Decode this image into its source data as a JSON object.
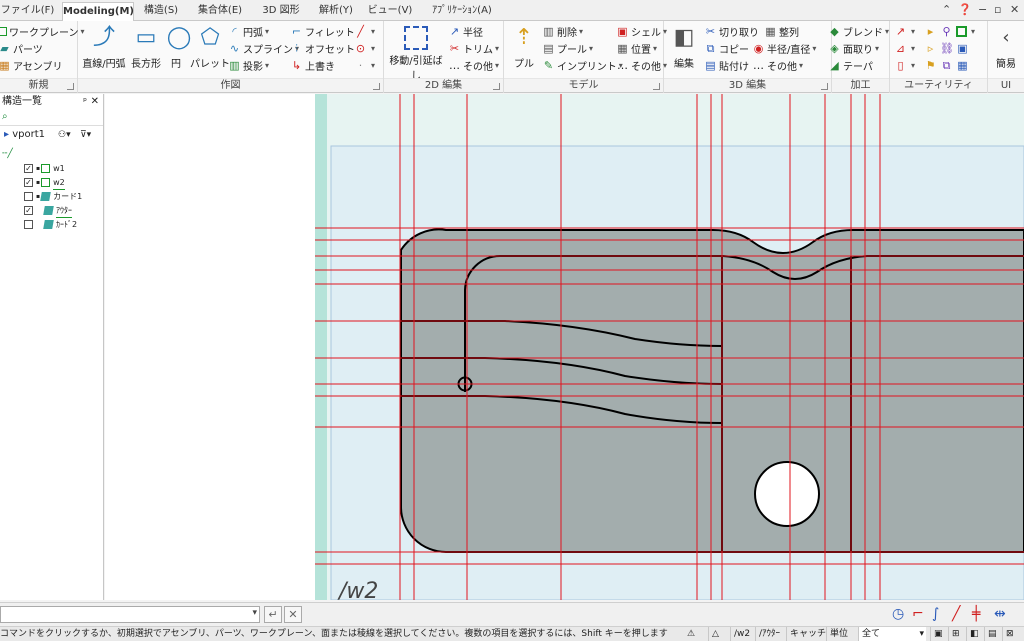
{
  "tabs": [
    {
      "label": "ファイル(F)",
      "active": false
    },
    {
      "label": "Modeling(M)",
      "active": true
    },
    {
      "label": "構造(S)",
      "active": false
    },
    {
      "label": "集合体(E)",
      "active": false
    },
    {
      "label": "3D 図形",
      "active": false
    },
    {
      "label": "解析(Y)",
      "active": false
    },
    {
      "label": "ビュー(V)",
      "active": false
    },
    {
      "label": "ｱﾌﾟﾘｹｰｼｮﾝ(A)",
      "active": false
    }
  ],
  "ribbon": {
    "groups": {
      "new": "新規",
      "draw": "作図",
      "edit2d": "2D 編集",
      "model": "モデル",
      "edit3d": "3D 編集",
      "machining": "加工",
      "utility": "ユーティリティ",
      "ui": "UI"
    },
    "new": {
      "workplane": "ワークプレーン",
      "parts": "パーツ",
      "assembly": "アセンブリ"
    },
    "draw": {
      "line_arc": "直線/円弧",
      "rect": "長方形",
      "circle": "円",
      "pallet": "パレット",
      "arc": "円弧",
      "spline": "スプライン",
      "projection": "投影",
      "fillet": "フィレット",
      "offset": "オフセット",
      "overwrite": "上書き"
    },
    "edit2d": {
      "move_extend": "移動/引延ばし",
      "radius": "半径",
      "trim": "トリム",
      "other": "その他"
    },
    "model": {
      "pull": "プル",
      "delete": "削除",
      "pool": "プール",
      "imprint": "インプリント",
      "shell": "シェル",
      "position": "位置",
      "other": "その他"
    },
    "edit3d": {
      "edit": "編集",
      "cut": "切り取り",
      "copy": "コピー",
      "paste": "貼付け",
      "align": "整列",
      "radius_dia": "半径/直径",
      "other": "その他"
    },
    "machining": {
      "blend": "ブレンド",
      "chamfer": "面取り",
      "taper": "テーパ"
    },
    "ui": {
      "simple": "簡易"
    }
  },
  "panel": {
    "title": "構造一覧",
    "vport": "vport1",
    "items": [
      {
        "label": "w1",
        "checked": true,
        "type": "workplane"
      },
      {
        "label": "w2",
        "checked": true,
        "type": "workplane"
      },
      {
        "label": "カード1",
        "checked": false,
        "type": "part"
      },
      {
        "label": "ｱｳﾀｰ",
        "checked": true,
        "type": "part"
      },
      {
        "label": "ｶｰﾄﾞ2",
        "checked": false,
        "type": "part"
      }
    ]
  },
  "viewport": {
    "workplane_label": "/w2"
  },
  "status": {
    "message": "コマンドをクリックするか、初期選択でアセンブリ、パーツ、ワークプレーン、面または稜線を選択してください。複数の項目を選択するには、Shift キーを押します",
    "workplane": "/w2",
    "part": "/ｱｳﾀｰ",
    "catch": "キャッチ",
    "unit": "単位",
    "filter": "全て"
  },
  "colors": {
    "accent": "#1a8a3a",
    "grid_red": "#e0141e",
    "part_fill": "#a3adad",
    "workplane_bg": "#e6f4f2"
  }
}
